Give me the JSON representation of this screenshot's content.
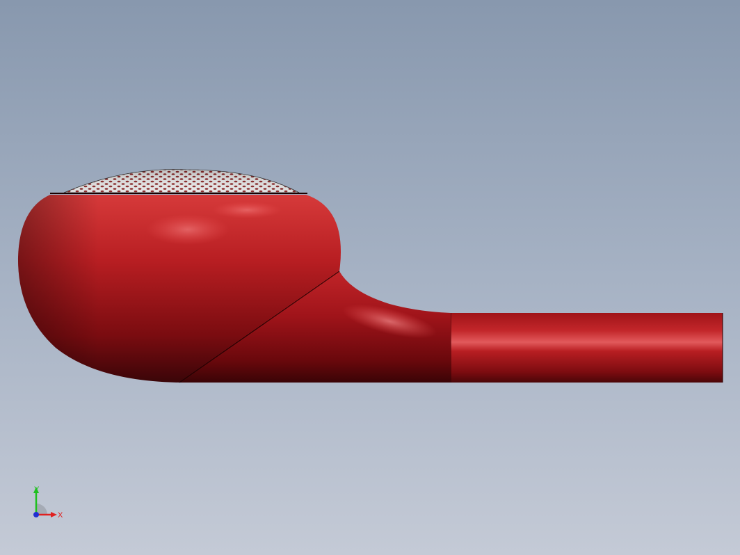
{
  "viewport": {
    "background_top": "#8898ae",
    "background_bottom": "#c4cad6"
  },
  "model": {
    "body_color": "#b81e22",
    "mesh_color": "#9a9a9a"
  },
  "triad": {
    "x_label": "X",
    "y_label": "Y",
    "x_color": "#e02020",
    "y_color": "#20c020",
    "z_color": "#2030d0"
  }
}
